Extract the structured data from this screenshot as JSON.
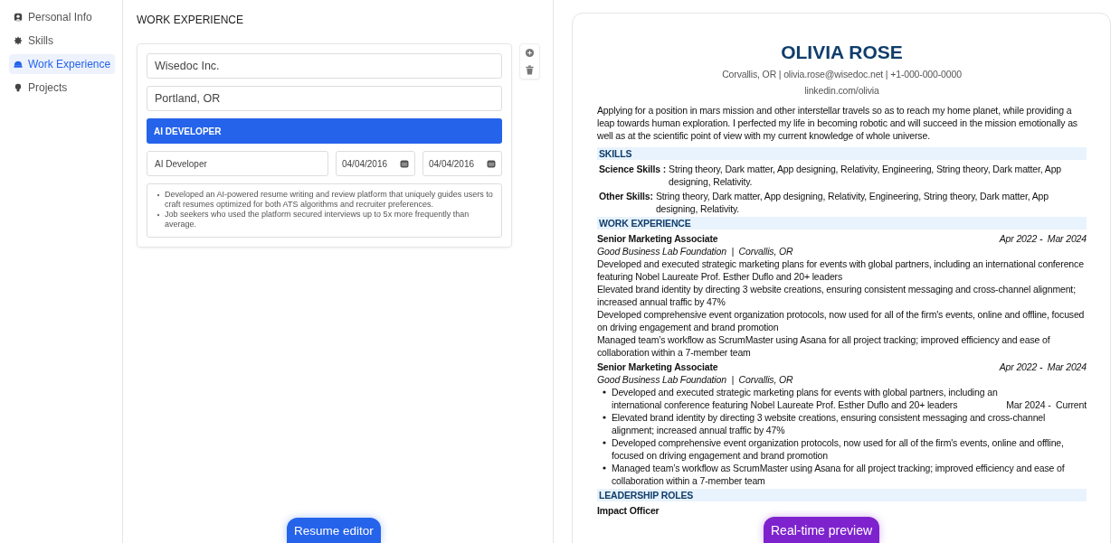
{
  "sidebar": {
    "items": [
      {
        "label": "Personal Info",
        "selected": false
      },
      {
        "label": "Skills",
        "selected": false
      },
      {
        "label": "Work Experience",
        "selected": true
      },
      {
        "label": "Projects",
        "selected": false
      }
    ]
  },
  "editor": {
    "title": "WORK EXPERIENCE",
    "company": "Wisedoc Inc.",
    "location": "Portland, OR",
    "role_header": "AI DEVELOPER",
    "position": "AI Developer",
    "start_date": "04/04/2016",
    "end_date": "04/04/2016",
    "bullets": [
      "Developed an AI-powered resume writing and review platform that uniquely guides users to craft resumes optimized for both ATS algorithms and recruiter preferences.",
      "Job seekers who used the platform secured interviews up to 5x more frequently than average."
    ],
    "badge": "Resume editor"
  },
  "preview": {
    "name": "OLIVIA ROSE",
    "contact": "Corvallis, OR | olivia.rose@wisedoc.net | +1-000-000-0000",
    "linkedin": "linkedin.com/olivia",
    "summary": "Applying for a position in mars mission and other interstellar travels so as to reach my home planet, while providing a leap towards human exploration. I perfected my life in becoming robotic and will succeed in the mission emotionally as well as at the scientific point of view with my current knowledge of whole universe.",
    "skills": {
      "heading": "SKILLS",
      "rows": [
        {
          "label": "Science Skills :",
          "value": "String theory, Dark matter, App designing, Relativity, Engineering, String theory, Dark matter, App designing, Relativity."
        },
        {
          "label": "Other Skills:",
          "value": "String theory, Dark matter, App designing, Relativity, Engineering, String theory, Dark matter, App designing, Relativity."
        }
      ]
    },
    "work": {
      "heading": "WORK EXPERIENCE",
      "jobs": [
        {
          "kind": "plain",
          "title": "Senior Marketing Associate",
          "dates": "Apr 2022 -  Mar 2024",
          "company": "Good Business Lab Foundation  |  Corvallis, OR",
          "bullets": [
            "Developed and executed strategic marketing plans for events with global partners, including an international conference featuring Nobel Laureate Prof. Esther Duflo and 20+ leaders",
            "Elevated brand identity by directing 3 website creations, ensuring consistent messaging and cross-channel alignment; increased annual traffic by 47%",
            "Developed comprehensive event organization protocols, now used for all of the firm's events, online and offline, focused on driving engagement and brand promotion",
            "Managed team’s workflow as ScrumMaster using Asana for all project tracking; improved efficiency and ease of collaboration within a 7-member team"
          ]
        },
        {
          "kind": "bulleted",
          "title": "Senior Marketing Associate",
          "dates": "Apr 2022 -  Mar 2024",
          "company": "Good Business Lab Foundation  |  Corvallis, OR",
          "extra_date": "Mar 2024 -  Current",
          "bullets": [
            "Developed and executed strategic marketing plans for events with global partners, including an international conference featuring Nobel Laureate Prof. Esther Duflo and 20+ leaders",
            "Elevated brand identity by directing 3 website creations, ensuring consistent messaging and cross-channel alignment; increased annual traffic by 47%",
            "Developed comprehensive event organization protocols, now used for all of the firm's events, online and offline, focused on driving engagement and brand promotion",
            "Managed team’s workflow as ScrumMaster using Asana for all project tracking; improved efficiency and ease of collaboration within a 7-member team"
          ]
        }
      ]
    },
    "leadership": {
      "heading": "LEADERSHIP ROLES",
      "jobs": [
        {
          "title": "Impact Officer"
        }
      ]
    },
    "badge": "Real-time preview"
  }
}
